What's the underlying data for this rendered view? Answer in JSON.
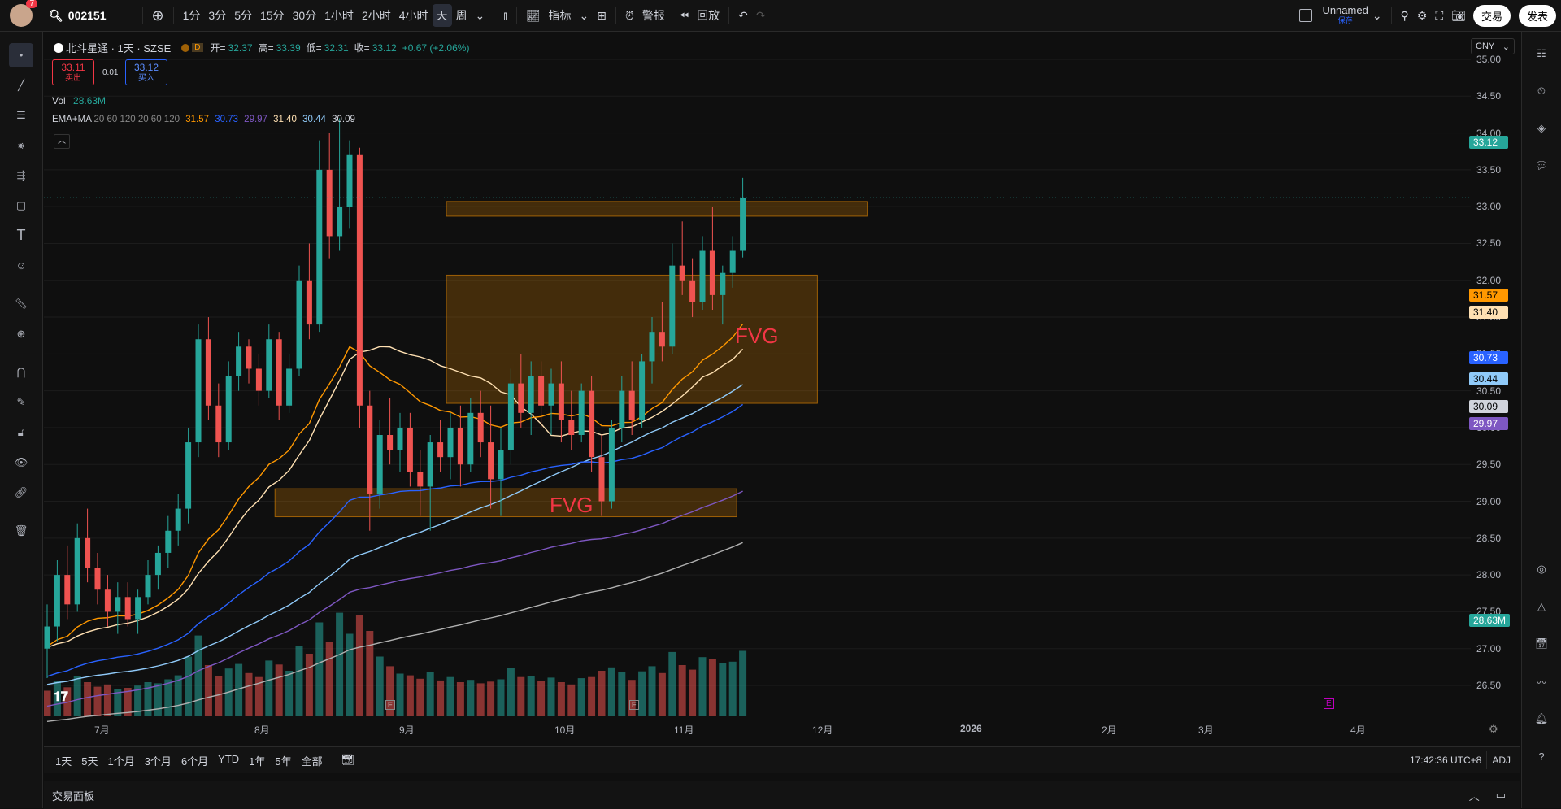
{
  "header": {
    "avatar_badge": "7",
    "symbol_input": "002151",
    "timeframes": [
      "1分",
      "3分",
      "5分",
      "15分",
      "30分",
      "1小时",
      "2小时",
      "4小时",
      "天",
      "周"
    ],
    "active_timeframe": "天",
    "indicators_label": "指标",
    "alert_label": "警报",
    "replay_label": "回放",
    "layout_name": "Unnamed",
    "layout_sub": "保存",
    "trade_button": "交易",
    "publish_button": "发表"
  },
  "symbol_legend": {
    "title": "北斗星通 · 1天 · SZSE",
    "d_badge": "D",
    "open_label": "开=",
    "open": "32.37",
    "high_label": "高=",
    "high": "33.39",
    "low_label": "低=",
    "low": "32.31",
    "close_label": "收=",
    "close": "33.12",
    "change": "+0.67 (+2.06%)"
  },
  "order": {
    "sell_price": "33.11",
    "sell_label": "卖出",
    "spread": "0.01",
    "buy_price": "33.12",
    "buy_label": "买入"
  },
  "vol_legend": {
    "label": "Vol",
    "value": "28.63M"
  },
  "ema_legend": {
    "label": "EMA+MA",
    "params": "20 60 120 20 60 120",
    "values": [
      "31.57",
      "30.73",
      "29.97",
      "31.40",
      "30.44",
      "30.09"
    ]
  },
  "currency": "CNY",
  "annotations": [
    "FVG",
    "FVG"
  ],
  "price_axis": [
    "35.00",
    "34.50",
    "34.00",
    "33.50",
    "33.00",
    "32.50",
    "32.00",
    "31.50",
    "31.00",
    "30.50",
    "30.00",
    "29.50",
    "29.00",
    "28.50",
    "28.00",
    "27.50",
    "27.00",
    "26.50"
  ],
  "price_labels": {
    "last": "33.12",
    "ema20": "31.57",
    "ma20": "31.40",
    "ema60": "30.73",
    "ma60": "30.44",
    "ma120": "30.09",
    "ema120": "29.97",
    "vol": "28.63M"
  },
  "time_axis": [
    "7月",
    "8月",
    "9月",
    "10月",
    "11月",
    "12月",
    "2026",
    "2月",
    "3月",
    "4月"
  ],
  "bottom": {
    "ranges": [
      "1天",
      "5天",
      "1个月",
      "3个月",
      "6个月",
      "YTD",
      "1年",
      "5年",
      "全部"
    ],
    "clock": "17:42:36 UTC+8",
    "adj": "ADJ",
    "panel_title": "交易面板"
  },
  "colors": {
    "up": "#26a69a",
    "down": "#ef5350",
    "ema20": "#ff9800",
    "ma20": "#ffe0b2",
    "ema60": "#2962ff",
    "ma60": "#90caf9",
    "ema120": "#7e57c2",
    "ma120": "#b0b0b0"
  },
  "chart_data": {
    "type": "candlestick",
    "symbol": "北斗星通",
    "interval": "1天",
    "ylim": [
      26.3,
      35.3
    ],
    "x": [
      "7月",
      "8月",
      "9月",
      "10月",
      "11月",
      "12月"
    ],
    "candles": [
      {
        "o": 27.0,
        "h": 27.6,
        "l": 26.6,
        "c": 27.3
      },
      {
        "o": 27.3,
        "h": 28.2,
        "l": 27.1,
        "c": 28.0
      },
      {
        "o": 28.0,
        "h": 28.4,
        "l": 27.4,
        "c": 27.6
      },
      {
        "o": 27.6,
        "h": 28.7,
        "l": 27.5,
        "c": 28.5
      },
      {
        "o": 28.5,
        "h": 28.9,
        "l": 27.9,
        "c": 28.1
      },
      {
        "o": 28.1,
        "h": 28.3,
        "l": 27.6,
        "c": 27.8
      },
      {
        "o": 27.8,
        "h": 28.0,
        "l": 27.3,
        "c": 27.5
      },
      {
        "o": 27.5,
        "h": 27.9,
        "l": 27.2,
        "c": 27.7
      },
      {
        "o": 27.7,
        "h": 27.9,
        "l": 27.3,
        "c": 27.4
      },
      {
        "o": 27.4,
        "h": 27.8,
        "l": 27.2,
        "c": 27.7
      },
      {
        "o": 27.7,
        "h": 28.2,
        "l": 27.6,
        "c": 28.0
      },
      {
        "o": 28.0,
        "h": 28.4,
        "l": 27.8,
        "c": 28.3
      },
      {
        "o": 28.3,
        "h": 28.8,
        "l": 28.1,
        "c": 28.6
      },
      {
        "o": 28.6,
        "h": 29.1,
        "l": 28.4,
        "c": 28.9
      },
      {
        "o": 28.9,
        "h": 30.0,
        "l": 28.7,
        "c": 29.8
      },
      {
        "o": 29.8,
        "h": 31.4,
        "l": 29.6,
        "c": 31.2
      },
      {
        "o": 31.2,
        "h": 31.5,
        "l": 30.1,
        "c": 30.3
      },
      {
        "o": 30.3,
        "h": 30.6,
        "l": 29.6,
        "c": 29.8
      },
      {
        "o": 29.8,
        "h": 30.9,
        "l": 29.7,
        "c": 30.7
      },
      {
        "o": 30.7,
        "h": 31.3,
        "l": 30.5,
        "c": 31.1
      },
      {
        "o": 31.1,
        "h": 31.2,
        "l": 30.6,
        "c": 30.8
      },
      {
        "o": 30.8,
        "h": 31.0,
        "l": 30.3,
        "c": 30.5
      },
      {
        "o": 30.5,
        "h": 31.4,
        "l": 30.4,
        "c": 31.2
      },
      {
        "o": 31.2,
        "h": 31.3,
        "l": 30.1,
        "c": 30.3
      },
      {
        "o": 30.3,
        "h": 31.0,
        "l": 30.2,
        "c": 30.8
      },
      {
        "o": 30.8,
        "h": 32.2,
        "l": 30.7,
        "c": 32.0
      },
      {
        "o": 32.0,
        "h": 32.5,
        "l": 31.2,
        "c": 31.4
      },
      {
        "o": 31.4,
        "h": 33.9,
        "l": 31.3,
        "c": 33.5
      },
      {
        "o": 33.5,
        "h": 34.0,
        "l": 32.3,
        "c": 32.6
      },
      {
        "o": 32.6,
        "h": 34.2,
        "l": 32.4,
        "c": 33.0
      },
      {
        "o": 33.0,
        "h": 33.9,
        "l": 32.7,
        "c": 33.7
      },
      {
        "o": 33.7,
        "h": 33.8,
        "l": 30.0,
        "c": 30.3
      },
      {
        "o": 30.3,
        "h": 30.5,
        "l": 28.6,
        "c": 29.1
      },
      {
        "o": 29.1,
        "h": 30.1,
        "l": 28.9,
        "c": 29.9
      },
      {
        "o": 29.9,
        "h": 30.4,
        "l": 29.5,
        "c": 29.7
      },
      {
        "o": 29.7,
        "h": 30.2,
        "l": 29.4,
        "c": 30.0
      },
      {
        "o": 30.0,
        "h": 30.2,
        "l": 29.2,
        "c": 29.4
      },
      {
        "o": 29.4,
        "h": 29.7,
        "l": 28.8,
        "c": 29.2
      },
      {
        "o": 29.2,
        "h": 29.9,
        "l": 28.6,
        "c": 29.8
      },
      {
        "o": 29.8,
        "h": 30.1,
        "l": 29.4,
        "c": 29.6
      },
      {
        "o": 29.6,
        "h": 30.2,
        "l": 29.3,
        "c": 30.0
      },
      {
        "o": 30.0,
        "h": 30.3,
        "l": 29.2,
        "c": 29.5
      },
      {
        "o": 29.5,
        "h": 30.4,
        "l": 29.4,
        "c": 30.2
      },
      {
        "o": 30.2,
        "h": 30.5,
        "l": 29.6,
        "c": 29.8
      },
      {
        "o": 29.8,
        "h": 30.3,
        "l": 28.9,
        "c": 29.3
      },
      {
        "o": 29.3,
        "h": 30.0,
        "l": 28.8,
        "c": 29.7
      },
      {
        "o": 29.7,
        "h": 30.8,
        "l": 29.5,
        "c": 30.6
      },
      {
        "o": 30.6,
        "h": 31.0,
        "l": 30.0,
        "c": 30.2
      },
      {
        "o": 30.2,
        "h": 30.9,
        "l": 29.9,
        "c": 30.7
      },
      {
        "o": 30.7,
        "h": 30.9,
        "l": 30.0,
        "c": 30.3
      },
      {
        "o": 30.3,
        "h": 30.8,
        "l": 29.9,
        "c": 30.6
      },
      {
        "o": 30.6,
        "h": 30.9,
        "l": 29.8,
        "c": 30.1
      },
      {
        "o": 30.1,
        "h": 30.5,
        "l": 29.7,
        "c": 29.9
      },
      {
        "o": 29.9,
        "h": 30.6,
        "l": 29.8,
        "c": 30.5
      },
      {
        "o": 30.5,
        "h": 30.7,
        "l": 29.4,
        "c": 29.6
      },
      {
        "o": 29.6,
        "h": 29.9,
        "l": 28.8,
        "c": 29.0
      },
      {
        "o": 29.0,
        "h": 30.1,
        "l": 28.9,
        "c": 30.0
      },
      {
        "o": 30.0,
        "h": 30.7,
        "l": 29.8,
        "c": 30.5
      },
      {
        "o": 30.5,
        "h": 30.9,
        "l": 29.9,
        "c": 30.1
      },
      {
        "o": 30.1,
        "h": 31.0,
        "l": 30.0,
        "c": 30.9
      },
      {
        "o": 30.9,
        "h": 31.5,
        "l": 30.6,
        "c": 31.3
      },
      {
        "o": 31.3,
        "h": 31.7,
        "l": 30.9,
        "c": 31.1
      },
      {
        "o": 31.1,
        "h": 32.5,
        "l": 31.0,
        "c": 32.2
      },
      {
        "o": 32.2,
        "h": 32.8,
        "l": 31.8,
        "c": 32.0
      },
      {
        "o": 32.0,
        "h": 32.3,
        "l": 31.5,
        "c": 31.7
      },
      {
        "o": 31.7,
        "h": 32.6,
        "l": 31.6,
        "c": 32.4
      },
      {
        "o": 32.4,
        "h": 33.0,
        "l": 31.6,
        "c": 31.8
      },
      {
        "o": 31.8,
        "h": 32.2,
        "l": 31.4,
        "c": 32.1
      },
      {
        "o": 32.1,
        "h": 32.6,
        "l": 31.9,
        "c": 32.4
      },
      {
        "o": 32.4,
        "h": 33.39,
        "l": 32.31,
        "c": 33.12
      }
    ],
    "volume": [
      {
        "v": 4.5,
        "up": false
      },
      {
        "v": 6.2,
        "up": true
      },
      {
        "v": 5.1,
        "up": false
      },
      {
        "v": 7.0,
        "up": true
      },
      {
        "v": 6.0,
        "up": false
      },
      {
        "v": 5.2,
        "up": false
      },
      {
        "v": 5.6,
        "up": false
      },
      {
        "v": 4.8,
        "up": true
      },
      {
        "v": 5.0,
        "up": false
      },
      {
        "v": 5.4,
        "up": true
      },
      {
        "v": 6.0,
        "up": true
      },
      {
        "v": 5.8,
        "up": true
      },
      {
        "v": 6.5,
        "up": true
      },
      {
        "v": 7.2,
        "up": true
      },
      {
        "v": 10.5,
        "up": true
      },
      {
        "v": 14.2,
        "up": true
      },
      {
        "v": 9.0,
        "up": false
      },
      {
        "v": 7.1,
        "up": false
      },
      {
        "v": 8.4,
        "up": true
      },
      {
        "v": 9.2,
        "up": true
      },
      {
        "v": 7.6,
        "up": false
      },
      {
        "v": 6.9,
        "up": false
      },
      {
        "v": 9.8,
        "up": true
      },
      {
        "v": 9.1,
        "up": false
      },
      {
        "v": 8.0,
        "up": true
      },
      {
        "v": 12.3,
        "up": true
      },
      {
        "v": 11.0,
        "up": false
      },
      {
        "v": 16.5,
        "up": true
      },
      {
        "v": 13.0,
        "up": false
      },
      {
        "v": 18.2,
        "up": true
      },
      {
        "v": 14.5,
        "up": true
      },
      {
        "v": 17.8,
        "up": false
      },
      {
        "v": 15.0,
        "up": false
      },
      {
        "v": 10.5,
        "up": true
      },
      {
        "v": 8.8,
        "up": false
      },
      {
        "v": 7.5,
        "up": true
      },
      {
        "v": 7.2,
        "up": false
      },
      {
        "v": 6.6,
        "up": false
      },
      {
        "v": 7.8,
        "up": true
      },
      {
        "v": 6.3,
        "up": false
      },
      {
        "v": 6.9,
        "up": true
      },
      {
        "v": 6.0,
        "up": false
      },
      {
        "v": 6.4,
        "up": true
      },
      {
        "v": 5.8,
        "up": false
      },
      {
        "v": 6.1,
        "up": false
      },
      {
        "v": 6.5,
        "up": true
      },
      {
        "v": 8.5,
        "up": true
      },
      {
        "v": 6.9,
        "up": false
      },
      {
        "v": 7.0,
        "up": true
      },
      {
        "v": 6.2,
        "up": false
      },
      {
        "v": 6.8,
        "up": true
      },
      {
        "v": 6.0,
        "up": false
      },
      {
        "v": 5.6,
        "up": false
      },
      {
        "v": 6.7,
        "up": true
      },
      {
        "v": 6.9,
        "up": false
      },
      {
        "v": 8.0,
        "up": false
      },
      {
        "v": 8.6,
        "up": true
      },
      {
        "v": 7.8,
        "up": true
      },
      {
        "v": 6.4,
        "up": false
      },
      {
        "v": 7.9,
        "up": true
      },
      {
        "v": 8.8,
        "up": true
      },
      {
        "v": 7.6,
        "up": false
      },
      {
        "v": 11.3,
        "up": true
      },
      {
        "v": 9.0,
        "up": false
      },
      {
        "v": 8.2,
        "up": false
      },
      {
        "v": 10.4,
        "up": true
      },
      {
        "v": 10.0,
        "up": false
      },
      {
        "v": 9.4,
        "up": true
      },
      {
        "v": 9.6,
        "up": true
      },
      {
        "v": 11.5,
        "up": true
      }
    ],
    "zones": [
      {
        "label": "",
        "y0": 33.07,
        "y1": 32.87,
        "x0": 40,
        "x1": 81
      },
      {
        "label": "FVG",
        "y0": 32.07,
        "y1": 30.33,
        "x0": 40,
        "x1": 76
      },
      {
        "label": "FVG",
        "y0": 29.17,
        "y1": 28.79,
        "x0": 23,
        "x1": 68
      }
    ],
    "last_price": 33.12
  }
}
